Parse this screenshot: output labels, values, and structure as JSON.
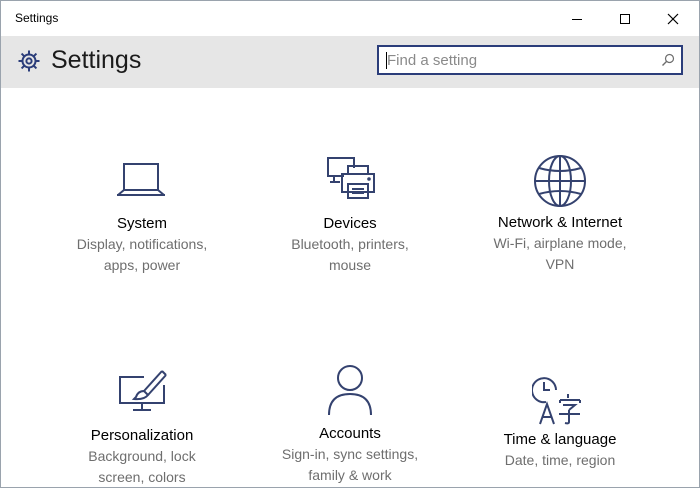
{
  "window": {
    "title": "Settings"
  },
  "header": {
    "title": "Settings",
    "icon": "gear-icon"
  },
  "search": {
    "placeholder": "Find a setting",
    "value": "",
    "icon": "search-icon"
  },
  "colors": {
    "accent": "#2b3d7a",
    "icon_stroke": "#34426f",
    "header_bg": "#e6e6e6",
    "desc_text": "#6e6e6e"
  },
  "categories": [
    {
      "title": "System",
      "desc1": "Display, notifications,",
      "desc2": "apps, power",
      "icon": "laptop-icon"
    },
    {
      "title": "Devices",
      "desc1": "Bluetooth, printers,",
      "desc2": "mouse",
      "icon": "printer-icon"
    },
    {
      "title": "Network & Internet",
      "desc1": "Wi-Fi, airplane mode,",
      "desc2": "VPN",
      "icon": "globe-icon"
    },
    {
      "title": "Personalization",
      "desc1": "Background, lock",
      "desc2": "screen, colors",
      "icon": "paint-monitor-icon"
    },
    {
      "title": "Accounts",
      "desc1": "Sign-in, sync settings,",
      "desc2": "family & work",
      "icon": "person-icon"
    },
    {
      "title": "Time & language",
      "desc1": "Date, time, region",
      "desc2": "",
      "icon": "clock-language-icon"
    }
  ]
}
